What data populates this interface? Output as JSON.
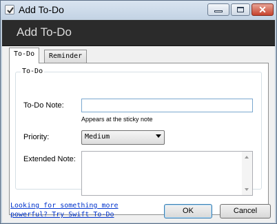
{
  "window": {
    "title": "Add To-Do",
    "controls": {
      "minimize": "minimize",
      "maximize": "maximize",
      "close": "✕"
    }
  },
  "header": {
    "title": "Add To-Do"
  },
  "tabs": [
    {
      "label": "To-Do",
      "active": true
    },
    {
      "label": "Reminder",
      "active": false
    }
  ],
  "form": {
    "group_legend": "To-Do",
    "todo_note": {
      "label": "To-Do Note:",
      "value": "",
      "placeholder": "",
      "hint": "Appears at the sticky note"
    },
    "priority": {
      "label": "Priority:",
      "selected": "Medium"
    },
    "extended_note": {
      "label": "Extended Note:",
      "value": ""
    }
  },
  "footer": {
    "link_text": "Looking for something more powerful? Try Swift To-Do",
    "ok_label": "OK",
    "cancel_label": "Cancel"
  },
  "colors": {
    "header_bg": "#2b2b2b",
    "header_text": "#dcdcdc",
    "link": "#0033cc",
    "input_focus_border": "#7aa7cf"
  },
  "icons": {
    "app": "checkbox-icon",
    "dropdown": "chevron-down-icon",
    "scroll_up": "arrow-up-icon",
    "scroll_down": "arrow-down-icon"
  }
}
